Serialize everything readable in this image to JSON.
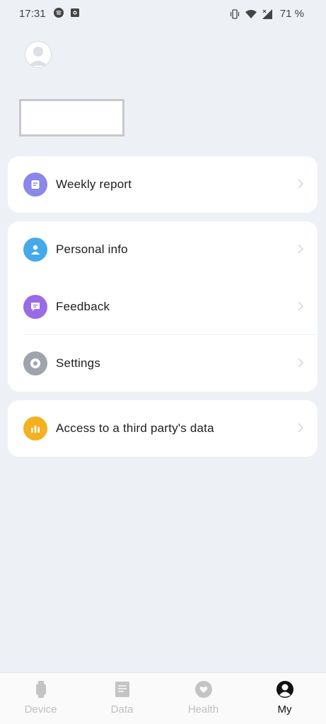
{
  "status_bar": {
    "time": "17:31",
    "battery": "71 %"
  },
  "menu": {
    "weekly_report": "Weekly report",
    "personal_info": "Personal info",
    "feedback": "Feedback",
    "settings": "Settings",
    "third_party": "Access to a third party's data"
  },
  "tabs": [
    {
      "label": "Device"
    },
    {
      "label": "Data"
    },
    {
      "label": "Health"
    },
    {
      "label": "My"
    }
  ],
  "colors": {
    "weekly_report": "#8a86ea",
    "personal_info": "#45a9ea",
    "feedback": "#9a6be6",
    "settings": "#9fa3ad",
    "third_party": "#f4b021"
  }
}
